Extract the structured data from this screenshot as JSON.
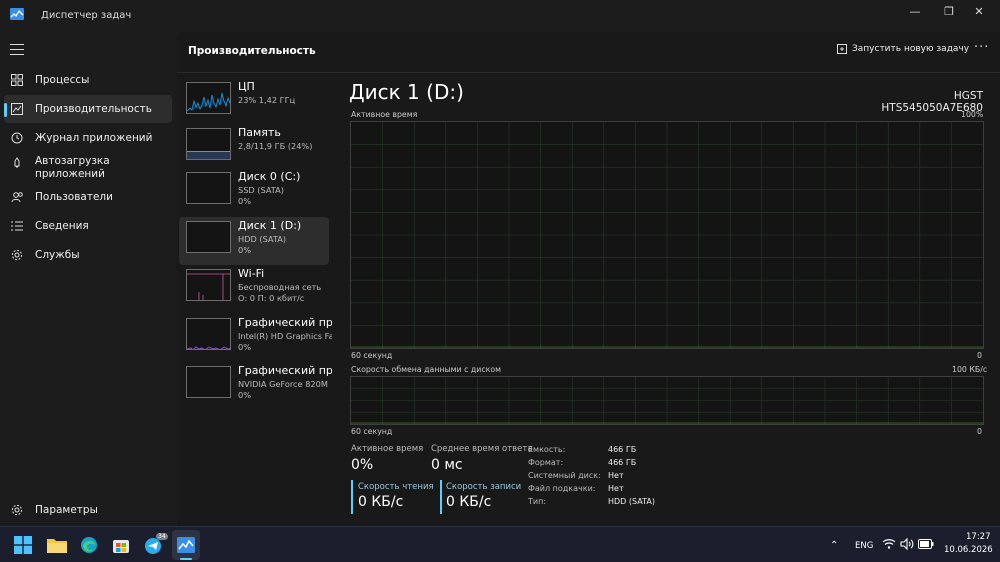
{
  "window": {
    "title": "Диспетчер задач",
    "controls": {
      "minimize": "—",
      "maximize": "❐",
      "close": "✕"
    }
  },
  "nav": {
    "items": [
      {
        "label": "Процессы",
        "icon": "processes-grid-icon"
      },
      {
        "label": "Производительность",
        "icon": "performance-chart-icon"
      },
      {
        "label": "Журнал приложений",
        "icon": "app-history-icon"
      },
      {
        "label": "Автозагрузка приложений",
        "icon": "startup-apps-icon"
      },
      {
        "label": "Пользователи",
        "icon": "users-icon"
      },
      {
        "label": "Сведения",
        "icon": "details-list-icon"
      },
      {
        "label": "Службы",
        "icon": "services-gear-icon"
      }
    ],
    "settings_label": "Параметры",
    "active_index": 1
  },
  "header": {
    "title": "Производительность",
    "run_task_label": "Запустить новую задачу",
    "more_label": "···"
  },
  "resources": [
    {
      "name": "ЦП",
      "sub1": "23%  1,42 ГГц",
      "sub2": "",
      "color": "#1a8fde"
    },
    {
      "name": "Память",
      "sub1": "2,8/11,9 ГБ (24%)",
      "sub2": "",
      "color": "#5a8ff0"
    },
    {
      "name": "Диск 0 (C:)",
      "sub1": "SSD (SATA)",
      "sub2": "0%",
      "color": "#6bbf3c"
    },
    {
      "name": "Диск 1 (D:)",
      "sub1": "HDD (SATA)",
      "sub2": "0%",
      "color": "#6bbf3c"
    },
    {
      "name": "Wi-Fi",
      "sub1": "Беспроводная сеть",
      "sub2": "О: 0 П: 0 кбит/с",
      "color": "#d4549b"
    },
    {
      "name": "Графический про",
      "sub1": "Intel(R) HD Graphics Far",
      "sub2": "0%",
      "color": "#9b54d4"
    },
    {
      "name": "Графический про",
      "sub1": "NVIDIA GeForce 820M",
      "sub2": "0%",
      "color": "#9b54d4"
    }
  ],
  "active_resource_index": 3,
  "detail": {
    "title": "Диск 1 (D:)",
    "model": "HGST HTS545050A7E680",
    "graph1": {
      "label": "Активное время",
      "max": "100%",
      "time_left": "60 секунд",
      "time_right": "0"
    },
    "graph2": {
      "label": "Скорость обмена данными с диском",
      "max": "100 КБ/с",
      "time_left": "60 секунд",
      "time_right": "0"
    },
    "stats": {
      "active_time_label": "Активное время",
      "active_time_value": "0%",
      "avg_response_label": "Среднее время ответа",
      "avg_response_value": "0 мс",
      "read_speed_label": "Скорость чтения",
      "read_speed_value": "0 КБ/с",
      "write_speed_label": "Скорость записи",
      "write_speed_value": "0 КБ/с"
    },
    "properties": [
      {
        "key": "Емкость:",
        "value": "466 ГБ"
      },
      {
        "key": "Формат:",
        "value": "466 ГБ"
      },
      {
        "key": "Системный диск:",
        "value": "Нет"
      },
      {
        "key": "Файл подкачки:",
        "value": "Нет"
      },
      {
        "key": "Тип:",
        "value": "HDD (SATA)"
      }
    ],
    "accent_disk": "#6bbf3c",
    "accent_read": "#60cdff",
    "accent_write": "#60cdff"
  },
  "taskbar": {
    "apps": [
      "start-icon",
      "file-explorer-icon",
      "edge-icon",
      "store-icon",
      "telegram-icon",
      "task-manager-icon"
    ],
    "telegram_badge": "34",
    "lang": "ENG",
    "time": "17:27",
    "date": "10.06.2026"
  }
}
